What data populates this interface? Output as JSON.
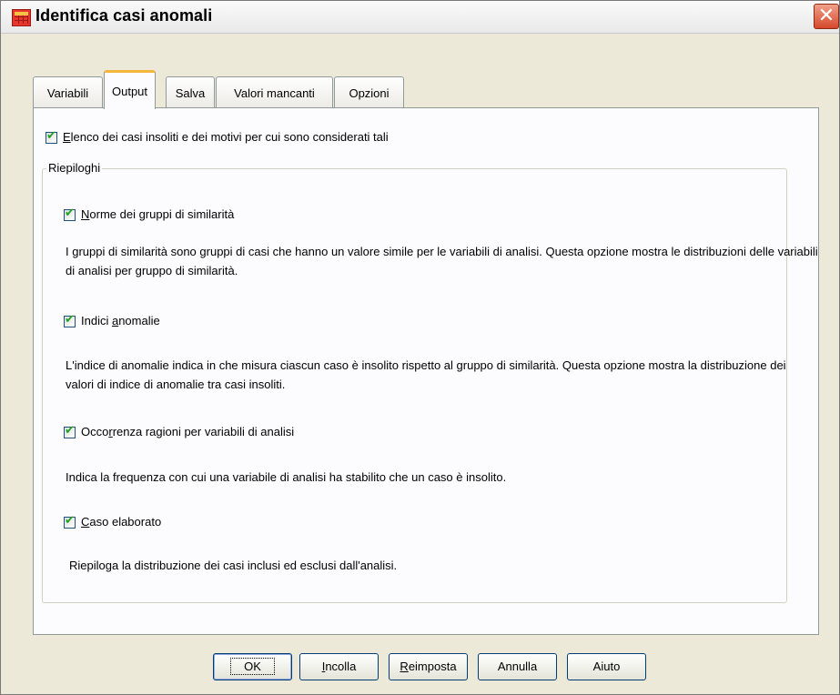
{
  "window": {
    "title": "Identifica casi anomali",
    "close_label": "✕"
  },
  "tabs": [
    {
      "label": "Variabili",
      "active": false
    },
    {
      "label": "Output",
      "active": true
    },
    {
      "label": "Salva",
      "active": false
    },
    {
      "label": "Valori mancanti",
      "active": false
    },
    {
      "label": "Opzioni",
      "active": false
    }
  ],
  "output": {
    "list_unusual": {
      "checked": true,
      "label_accel": "E",
      "label_rest": "lenco dei casi insoliti e dei motivi per cui sono considerati tali"
    },
    "summaries_group_title": "Riepiloghi",
    "peer_norms": {
      "checked": true,
      "label_accel": "N",
      "label_rest": "orme dei gruppi di similarità",
      "description": "I gruppi di similarità sono gruppi di casi che hanno un valore simile per le variabili di analisi. Questa opzione mostra le distribuzioni delle variabili di analisi per gruppo di similarità."
    },
    "anomaly_indices": {
      "checked": true,
      "label_pre": "Indici ",
      "label_accel": "a",
      "label_rest": "nomalie",
      "description": "L'indice di anomalie indica in che misura ciascun caso è insolito rispetto al gruppo di similarità. Questa opzione mostra la distribuzione dei valori di indice di anomalie tra casi insoliti."
    },
    "reason_occurrence": {
      "checked": true,
      "label_pre": "Occo",
      "label_accel": "r",
      "label_rest": "renza ragioni per variabili di analisi",
      "description": "Indica la frequenza con cui una variabile di analisi ha stabilito che un caso è insolito."
    },
    "case_processed": {
      "checked": true,
      "label_accel": "C",
      "label_rest": "aso elaborato",
      "description": "Riepiloga la distribuzione dei casi inclusi ed esclusi dall'analisi."
    }
  },
  "buttons": {
    "ok": "OK",
    "paste": "Incolla",
    "reset": "Reimposta",
    "cancel": "Annulla",
    "help": "Aiuto"
  }
}
